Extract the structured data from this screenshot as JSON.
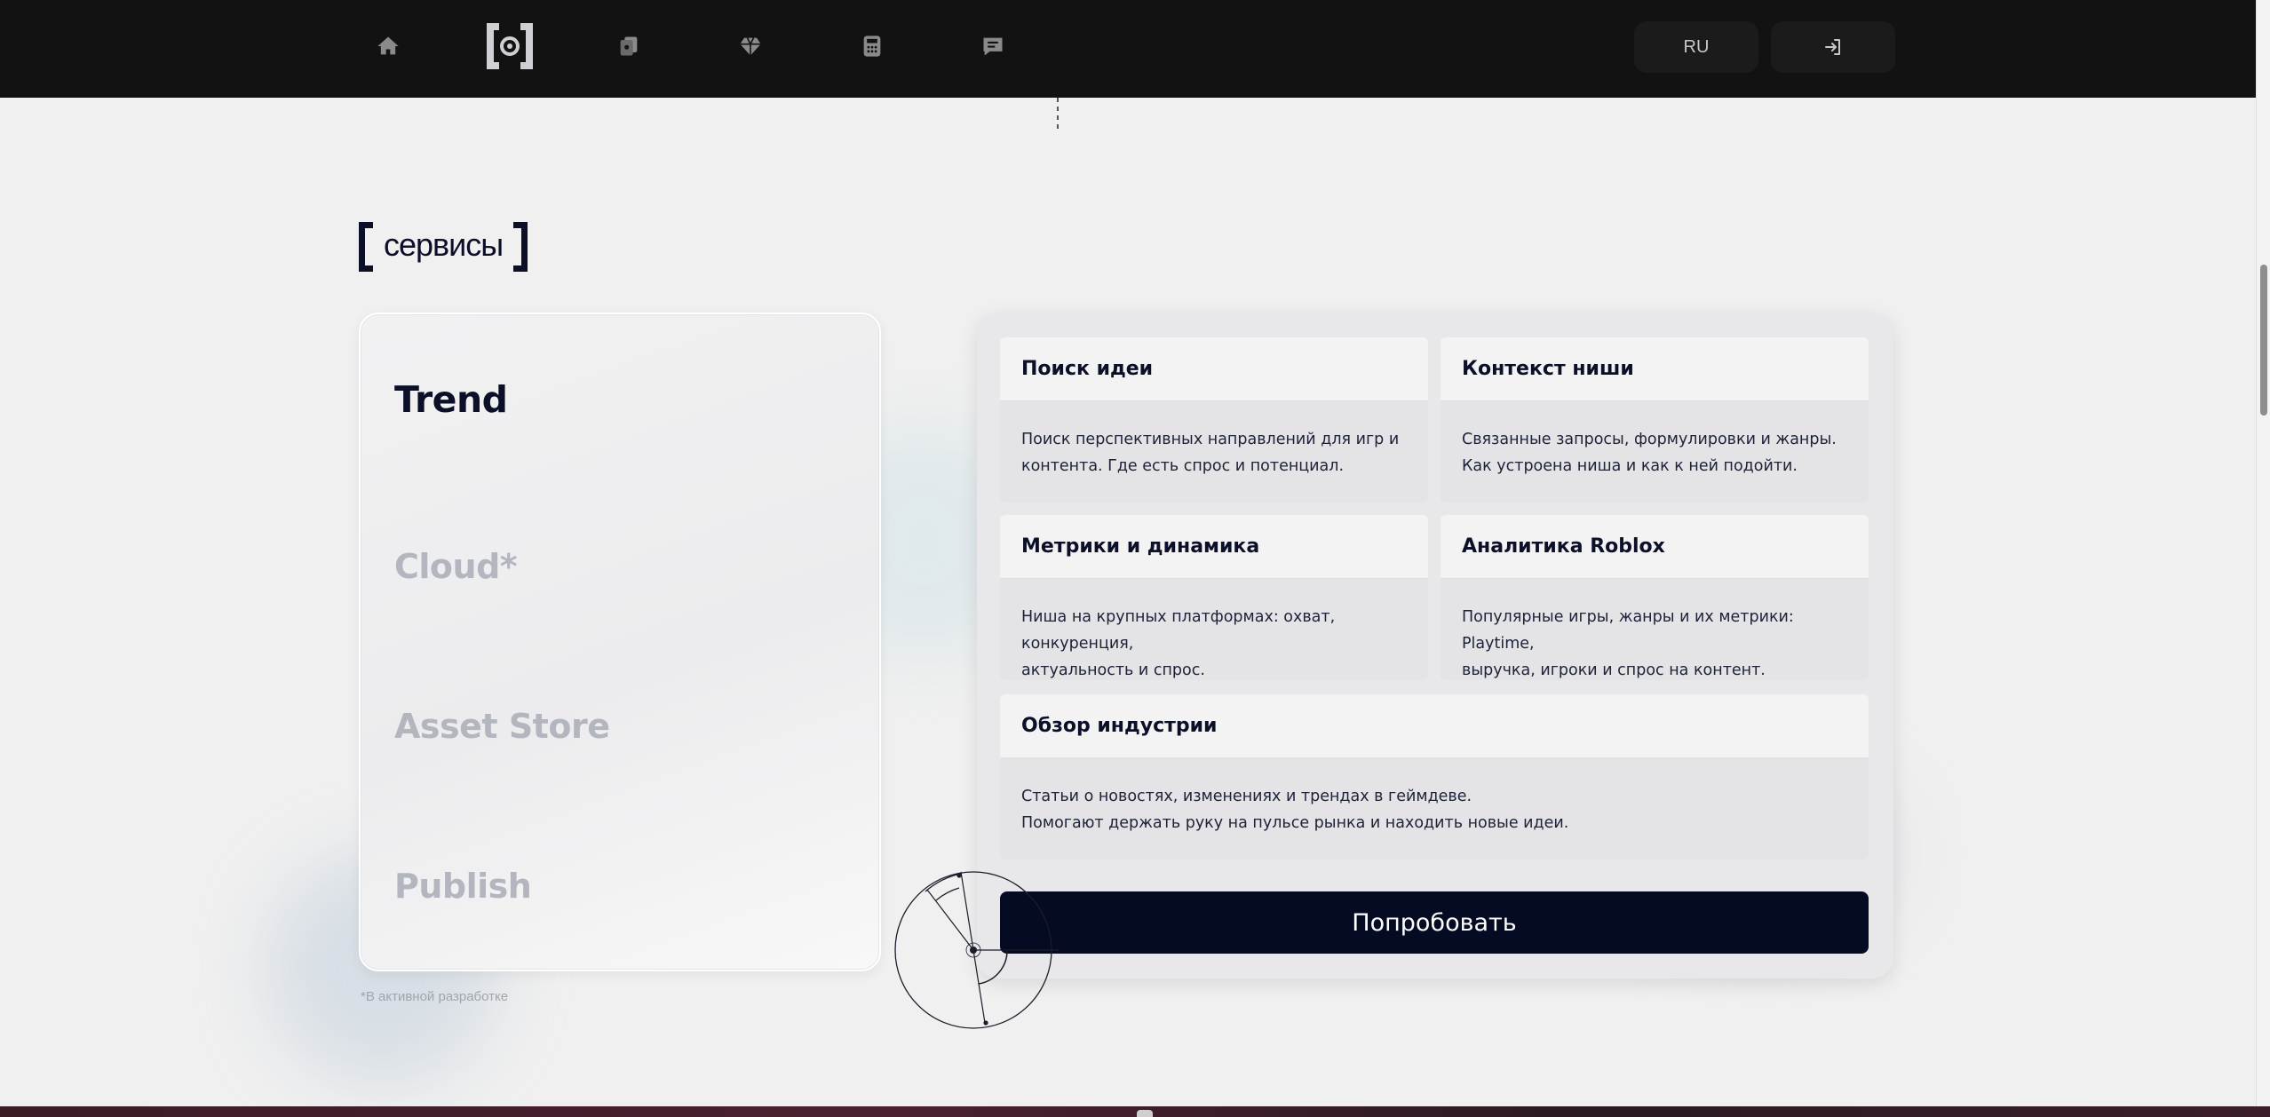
{
  "nav": {
    "icons": [
      "home-icon",
      "logo-mark",
      "cards-icon",
      "diamond-icon",
      "calculator-icon",
      "chat-icon"
    ],
    "lang_label": "RU",
    "login_icon": "login-icon"
  },
  "section": {
    "title": "сервисы"
  },
  "tabs": [
    {
      "label": "Trend",
      "active": true
    },
    {
      "label": "Cloud*",
      "active": false
    },
    {
      "label": "Asset Store",
      "active": false
    },
    {
      "label": "Publish",
      "active": false
    }
  ],
  "footnote": "*В активной разработке",
  "features": [
    {
      "title": "Поиск идеи",
      "lines": [
        "Поиск перспективных направлений для игр и",
        "контента. Где есть спрос и потенциал."
      ]
    },
    {
      "title": "Контекст ниши",
      "lines": [
        "Связанные запросы, формулировки и жанры.",
        "Как устроена ниша и как к ней подойти."
      ]
    },
    {
      "title": "Метрики и динамика",
      "lines": [
        "Ниша на крупных платформах: охват, конкуренция,",
        "актуальность и спрос."
      ]
    },
    {
      "title": "Аналитика Roblox",
      "lines": [
        "Популярные игры, жанры и их метрики: Playtime,",
        "выручка, игроки и спрос на контент."
      ]
    },
    {
      "title": "Обзор индустрии",
      "lines": [
        "Статьи о новостях, изменениях и трендах в геймдеве.",
        "Помогают держать руку на пульсе рынка и находить новые идеи."
      ]
    }
  ],
  "cta_label": "Попробовать",
  "colors": {
    "navbar": "#121212",
    "primary_dark": "#050b22",
    "text_dark": "#0b1028",
    "tab_inactive": "#b3b6be",
    "background": "#f0f0f0"
  }
}
